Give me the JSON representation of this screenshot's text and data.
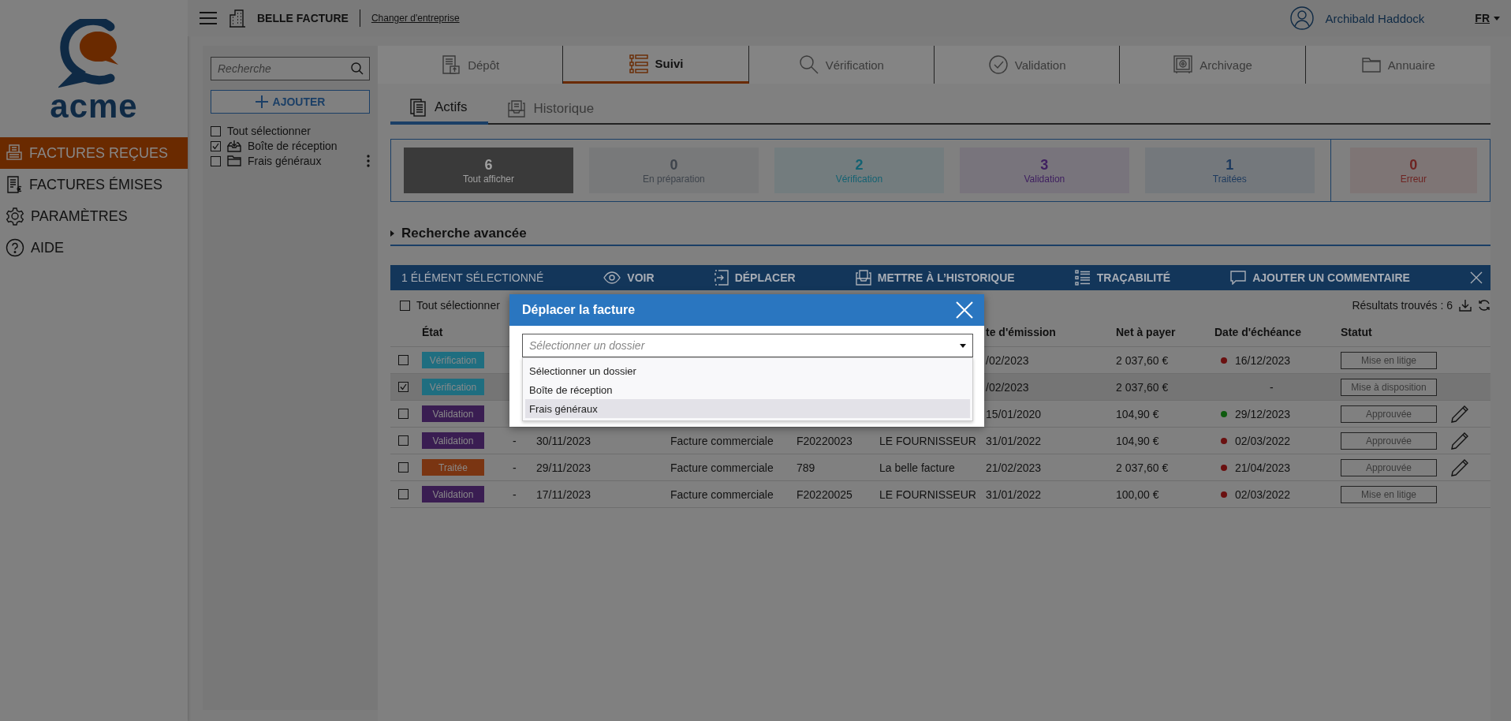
{
  "sidebar": {
    "logo": "acme",
    "items": [
      {
        "kind": "received",
        "label": "FACTURES REÇUES",
        "selected": true
      },
      {
        "kind": "issued",
        "label": "FACTURES ÉMISES",
        "selected": false
      },
      {
        "kind": "settings",
        "label": "PARAMÈTRES",
        "selected": false
      },
      {
        "kind": "help",
        "label": "AIDE",
        "selected": false
      }
    ]
  },
  "header": {
    "company": "BELLE FACTURE",
    "change_link": "Changer d'entreprise",
    "user": "Archibald Haddock",
    "language": "FR"
  },
  "folders": {
    "search": {
      "placeholder": "Recherche"
    },
    "add_button": "AJOUTER",
    "items": [
      {
        "kind": "select-all",
        "label": "Tout sélectionner",
        "checked": false,
        "menu": false
      },
      {
        "kind": "inbox",
        "label": "Boîte de réception",
        "checked": true,
        "menu": false
      },
      {
        "kind": "folder",
        "label": "Frais généraux",
        "checked": false,
        "menu": true
      }
    ]
  },
  "tabs": [
    {
      "kind": "upload",
      "label": "Dépôt",
      "selected": false
    },
    {
      "kind": "list",
      "label": "Suivi",
      "selected": true
    },
    {
      "kind": "search",
      "label": "Vérification",
      "selected": false
    },
    {
      "kind": "check",
      "label": "Validation",
      "selected": false
    },
    {
      "kind": "safe",
      "label": "Archivage",
      "selected": false
    },
    {
      "kind": "folder",
      "label": "Annuaire",
      "selected": false
    }
  ],
  "subtabs": [
    {
      "kind": "active",
      "label": "Actifs",
      "selected": true
    },
    {
      "kind": "history",
      "label": "Historique",
      "selected": false
    }
  ],
  "tiles": [
    {
      "kind": "status",
      "count": "6",
      "label": "Tout afficher",
      "color": "#3a3a3a",
      "selected": true
    },
    {
      "kind": "status",
      "count": "0",
      "label": "En préparation",
      "color": "#3e444c",
      "selected": false
    },
    {
      "kind": "status",
      "count": "2",
      "label": "Vérification",
      "color": "#136272",
      "selected": false
    },
    {
      "kind": "status",
      "count": "3",
      "label": "Validation",
      "color": "#3f2060",
      "selected": false
    },
    {
      "kind": "status",
      "count": "1",
      "label": "Traitées",
      "color": "#1d3a5e",
      "selected": false
    },
    {
      "kind": "error",
      "count": "0",
      "label": "Erreur",
      "color": "#6e2422",
      "selected": false
    }
  ],
  "advanced_search": {
    "label": "Recherche avancée",
    "expanded": false
  },
  "toolbar": {
    "selection": "1 ÉLÉMENT SÉLECTIONNÉ",
    "actions": [
      {
        "kind": "view",
        "label": "VOIR"
      },
      {
        "kind": "move",
        "label": "DÉPLACER"
      },
      {
        "kind": "archive",
        "label": "METTRE À L’HISTORIQUE"
      },
      {
        "kind": "trace",
        "label": "TRAÇABILITÉ"
      },
      {
        "kind": "comment",
        "label": "AJOUTER UN COMMENTAIRE"
      }
    ]
  },
  "table": {
    "select_all": {
      "label": "Tout sélectionner",
      "checked": false
    },
    "results": "Résultats trouvés : 6",
    "columns": {
      "state": "État",
      "emission": "te d'émission",
      "net": "Net à payer",
      "due": "Date d'échéance",
      "status": "Statut"
    },
    "rows": [
      {
        "checked": false,
        "state": {
          "label": "Vérification",
          "color": "#1f6e80"
        },
        "emission": "/02/2023",
        "net": "2 037,60 €",
        "due": {
          "date": "16/12/2023",
          "color": "#6a1010"
        },
        "status": "Mise en litige",
        "editable": false
      },
      {
        "checked": true,
        "state": {
          "label": "Vérification",
          "color": "#1f6e80"
        },
        "emission": "/02/2023",
        "net": "2 037,60 €",
        "due": {
          "date": "-"
        },
        "status": "Mise à disposition",
        "editable": false
      },
      {
        "checked": false,
        "state": {
          "label": "Validation",
          "color": "#3a1d52"
        },
        "emission": "15/01/2020",
        "net": "104,90 €",
        "due": {
          "date": "29/12/2023",
          "color": "#0e5a0e"
        },
        "status": "Approuvée",
        "editable": true
      },
      {
        "checked": false,
        "state": {
          "label": "Validation",
          "color": "#3a1d52"
        },
        "dash": "-",
        "created": "30/11/2023",
        "type": "Facture commerciale",
        "number": "F20220023",
        "supplier": "LE FOURNISSEUR",
        "emission": "31/01/2022",
        "net": "104,90 €",
        "due": {
          "date": "02/03/2022",
          "color": "#6a1010"
        },
        "status": "Approuvée",
        "editable": true
      },
      {
        "checked": false,
        "state": {
          "label": "Traitée",
          "color": "#7a3512"
        },
        "dash": "-",
        "created": "29/11/2023",
        "type": "Facture commerciale",
        "number": "789",
        "supplier": "La belle facture",
        "emission": "21/02/2023",
        "net": "2 037,60 €",
        "due": {
          "date": "21/04/2023",
          "color": "#6a1010"
        },
        "status": "Approuvée",
        "editable": true
      },
      {
        "checked": false,
        "state": {
          "label": "Validation",
          "color": "#3a1d52"
        },
        "dash": "-",
        "created": "17/11/2023",
        "type": "Facture commerciale",
        "number": "F20220025",
        "supplier": "LE FOURNISSEUR",
        "emission": "31/01/2022",
        "net": "100,00 €",
        "due": {
          "date": "02/03/2022",
          "color": "#6a1010"
        },
        "status": "Mise en litige",
        "editable": false
      }
    ]
  },
  "dialog": {
    "title": "Déplacer la facture",
    "select": {
      "placeholder": "Sélectionner un dossier",
      "expanded": true
    },
    "options": [
      {
        "label": "Sélectionner un dossier",
        "selected": false
      },
      {
        "label": "Boîte de réception",
        "selected": false
      },
      {
        "label": "Frais généraux",
        "selected": true
      }
    ]
  }
}
